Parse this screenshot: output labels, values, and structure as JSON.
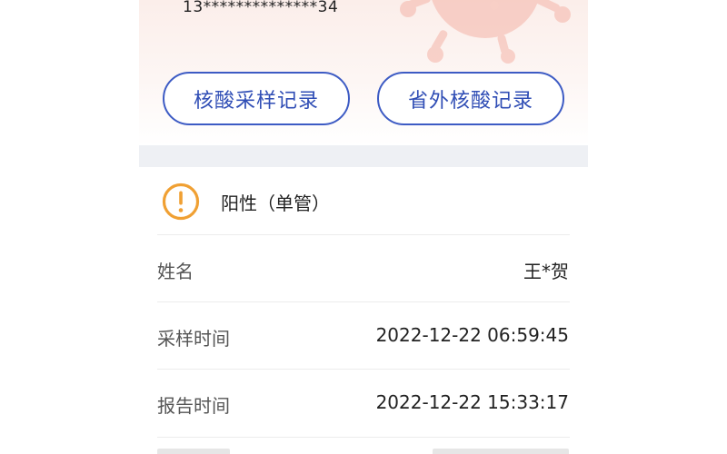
{
  "header": {
    "phone_number": "13**************34",
    "buttons": [
      {
        "label": "核酸采样记录"
      },
      {
        "label": "省外核酸记录"
      }
    ]
  },
  "result": {
    "status": "阳性（单管）",
    "icon": "warning-circle-icon",
    "status_color": "#f0a033"
  },
  "details": [
    {
      "label": "姓名",
      "value": "王*贺"
    },
    {
      "label": "采样时间",
      "value": "2022-12-22 06:59:45"
    },
    {
      "label": "报告时间",
      "value": "2022-12-22 15:33:17"
    }
  ],
  "colors": {
    "accent": "#3d5bc4",
    "header_bg": "#fbeeea"
  }
}
